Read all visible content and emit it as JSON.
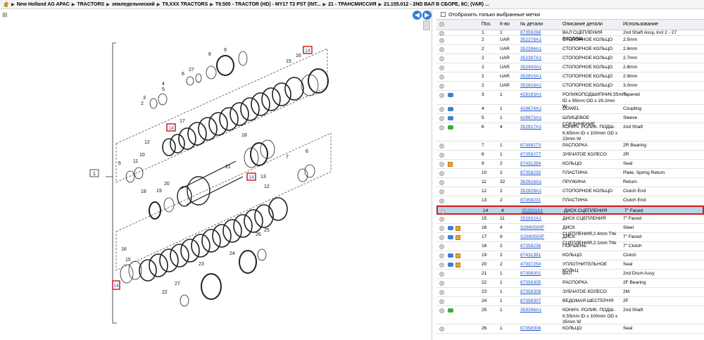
{
  "breadcrumb": {
    "items": [
      "New Holland AG APAC",
      "TRACTORS",
      "земледельческий",
      "T9.XXX TRACTORS",
      "T9.505 - TRACTOR (HD) - MY17 T2 PST (INT...",
      "21 - ТРАНСМИССИЯ",
      "21.155.012 - 2ND ВАЛ В СБОРЕ, 8С; (VAR) ..."
    ]
  },
  "filter_label": "Отобразить только выбранные метки",
  "table": {
    "headers": {
      "pos": "Поз.",
      "qty": "К-во",
      "part": "№ детали",
      "desc": "Описание детали",
      "usage": "Использование"
    },
    "rows": [
      {
        "pos": "1",
        "qty": "1",
        "part": "87359268",
        "desc": "ВАЛ СЦЕПЛЕНИЯ ВХОДЯЩ",
        "usage": "2nd Shaft Assy, Incl 2 - 27",
        "icons": []
      },
      {
        "pos": "2",
        "qty": "UAR",
        "part": "352378A1",
        "desc": "СТОПОРНОЕ КОЛЬЦО",
        "usage": "2.5mm",
        "icons": []
      },
      {
        "pos": "2",
        "qty": "UAR",
        "part": "352394A1",
        "desc": "СТОПОРНОЕ КОЛЬЦО",
        "usage": "2.6mm",
        "icons": []
      },
      {
        "pos": "2",
        "qty": "UAR",
        "part": "352397A1",
        "desc": "СТОПОРНОЕ КОЛЬЦО",
        "usage": "2.7mm",
        "icons": []
      },
      {
        "pos": "2",
        "qty": "UAR",
        "part": "352400A1",
        "desc": "СТОПОРНОЕ КОЛЬЦО",
        "usage": "2.8mm",
        "icons": []
      },
      {
        "pos": "2",
        "qty": "UAR",
        "part": "352815A1",
        "desc": "СТОПОРНОЕ КОЛЬЦО",
        "usage": "2.9mm",
        "icons": []
      },
      {
        "pos": "2",
        "qty": "UAR",
        "part": "352816A1",
        "desc": "СТОПОРНОЕ КОЛЬЦО",
        "usage": "3.0mm",
        "icons": []
      },
      {
        "pos": "3",
        "qty": "1",
        "part": "428183A1",
        "desc": "РОЛИКОПОДШИПНИК,55mm ID x 95mm OD x 29.2mm W",
        "usage": "Tapered",
        "icons": [
          "blue"
        ]
      },
      {
        "pos": "4",
        "qty": "1",
        "part": "428674A1",
        "desc": "DOWEL",
        "usage": "Coupling",
        "icons": [
          "blue"
        ]
      },
      {
        "pos": "5",
        "qty": "1",
        "part": "428673A1",
        "desc": "ШЛИЦЕВОЕ СОЕДИНЕНИЕ",
        "usage": "Sleeve",
        "icons": [
          "blue"
        ]
      },
      {
        "pos": "6",
        "qty": "4",
        "part": "352817A1",
        "desc": "КОНИЧ. РОЛИК. ПОДШ-К,65mm ID x 100mm OD x 23mm W",
        "usage": "2nd Shaft",
        "icons": [
          "green"
        ]
      },
      {
        "pos": "7",
        "qty": "1",
        "part": "87358273",
        "desc": "РАСПОРКА",
        "usage": "2R Bearing",
        "icons": []
      },
      {
        "pos": "8",
        "qty": "1",
        "part": "87358277",
        "desc": "ЗУБЧАТОЕ КОЛЕСО",
        "usage": "2R",
        "icons": []
      },
      {
        "pos": "9",
        "qty": "2",
        "part": "87431394",
        "desc": "КОЛЬЦО",
        "usage": "Seal",
        "icons": [
          "box"
        ]
      },
      {
        "pos": "10",
        "qty": "2",
        "part": "87358230",
        "desc": "ПЛАСТИНА",
        "usage": "Plate, Spring Return",
        "icons": []
      },
      {
        "pos": "11",
        "qty": "32",
        "part": "362616A1",
        "desc": "ПРУЖИНА",
        "usage": "Return",
        "icons": []
      },
      {
        "pos": "12",
        "qty": "2",
        "part": "352829A1",
        "desc": "СТОПОРНОЕ КОЛЬЦО",
        "usage": "Clutch End",
        "icons": []
      },
      {
        "pos": "13",
        "qty": "2",
        "part": "87358231",
        "desc": "ПЛАСТИНА",
        "usage": "Clutch End",
        "icons": []
      },
      {
        "pos": "14",
        "qty": "4",
        "part": "352831A1",
        "desc": "ДИСК СЦЕПЛЕНИЯ",
        "usage": "7\" Faced",
        "icons": [],
        "selected": true
      },
      {
        "pos": "15",
        "qty": "11",
        "part": "352832A1",
        "desc": "ДИСК СЦЕПЛЕНИЯ",
        "usage": "7\" Faced",
        "icons": []
      },
      {
        "pos": "16",
        "qty": "4",
        "part": "S2690500F",
        "desc": "ДИСК СЦЕПЛЕНИЯ,2.4mm Thk",
        "usage": "Steel",
        "icons": [
          "blue",
          "box"
        ]
      },
      {
        "pos": "17",
        "qty": "9",
        "part": "S2690500F",
        "desc": "ДИСК СЦЕПЛЕНИЯ,2.1mm Thk",
        "usage": "7\" Faced",
        "icons": [
          "blue",
          "box"
        ]
      },
      {
        "pos": "18",
        "qty": "2",
        "part": "87358236",
        "desc": "ПОРШЕНЬ",
        "usage": "7\" Clutch",
        "icons": []
      },
      {
        "pos": "19",
        "qty": "2",
        "part": "87431391",
        "desc": "КОЛЬЦО",
        "usage": "Clutch",
        "icons": [
          "blue",
          "box"
        ]
      },
      {
        "pos": "20",
        "qty": "2",
        "part": "47937254",
        "desc": "УПЛОТНИТЕЛЬНОЕ КОЛЬЦ",
        "usage": "Seal",
        "icons": [
          "blue",
          "box"
        ]
      },
      {
        "pos": "21",
        "qty": "1",
        "part": "87358301",
        "desc": "ВАЛ",
        "usage": "2nd Drum Assy",
        "icons": []
      },
      {
        "pos": "22",
        "qty": "1",
        "part": "87358305",
        "desc": "РАСПОРКА",
        "usage": "2F Bearing",
        "icons": []
      },
      {
        "pos": "23",
        "qty": "1",
        "part": "87358306",
        "desc": "ЗУБЧАТОЕ КОЛЕСО",
        "usage": "2M",
        "icons": []
      },
      {
        "pos": "24",
        "qty": "1",
        "part": "87358307",
        "desc": "ВЕДОМАЯ ШЕСТЕРНЯ",
        "usage": "2F",
        "icons": []
      },
      {
        "pos": "25",
        "qty": "1",
        "part": "359296A1",
        "desc": "КОНИЧ. РОЛИК. ПОДШ-К,55mm ID x 100mm OD x 35mm W",
        "usage": "2nd Shaft",
        "icons": [
          "green"
        ]
      },
      {
        "pos": "26",
        "qty": "1",
        "part": "87358308",
        "desc": "КОЛЬЦО",
        "usage": "Seal",
        "icons": []
      }
    ]
  },
  "diagram": {
    "callouts": [
      "1",
      "2",
      "3",
      "4",
      "5",
      "6",
      "7",
      "8",
      "9",
      "10",
      "11",
      "12",
      "13",
      "14",
      "15",
      "16",
      "17",
      "18",
      "19",
      "20",
      "21",
      "22",
      "23",
      "24",
      "25",
      "26",
      "27"
    ],
    "highlighted_callout": "14"
  }
}
